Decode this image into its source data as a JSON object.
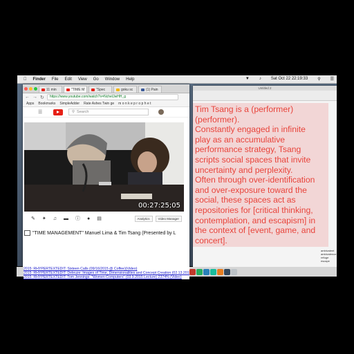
{
  "menubar": {
    "app": "Finder",
    "items": [
      "File",
      "Edit",
      "View",
      "Go",
      "Window",
      "Help"
    ],
    "clock": "Sat Oct 22  22:19:33"
  },
  "browser": {
    "tabs": [
      "11 min",
      "\"TIME M",
      "\"Spec",
      "goku sc",
      "(1) Pain"
    ],
    "url": "https://www.youtube.com/watch?v=NcheIJwHH_g",
    "bookmarks": [
      "Apps",
      "Bookmarks",
      "SimpleAdder",
      "Rate Ashes Twin ge",
      "m o n k e p r o p h e t"
    ],
    "search_placeholder": "Search",
    "video": {
      "timecode": "00:27:25;05"
    },
    "video_buttons": [
      "Analytics",
      "Video Manager"
    ],
    "video_title": "\"TIME MANAGEMENT\" Manuel Lima & Tim Tsang (Presented by L"
  },
  "links": [
    "2015: RHYPERTEXTEDIT: Sixteen Calls (09/16/2015 @ Coffee)(Video)",
    "2015: RHYPERTEXTEDIT: Deleuze: Images of Time, Dimensionalities and Concept Creation (02.13.2015)(Video)",
    "2015: RHYPERTEXTEDIT: Tom Jennings: \"Women Computers\" (03.9.2015 Lecture) 2374% (Video)"
  ],
  "textedit": {
    "window_title": "Untitled 2",
    "paragraph_lines": [
      "Tim Tsang is a (performer)",
      "(performer).",
      "Constantly engaged in infinite",
      "play as an accumulative",
      "performance strategy, Tsang",
      "scripts social spaces that invite",
      "uncertainty and perplexity.",
      "Often through over-identification",
      "and over-exposure toward the",
      "social, these spaces act as",
      "repositories for [critical thinking,",
      "contemplation, and escapism] in",
      "the context of [event, game, and",
      "concert]."
    ]
  },
  "finder_list": [
    "ambivalent",
    "ambivalence",
    "refuge",
    "escape"
  ],
  "colors": {
    "text_red": "#e8443b",
    "highlight": "#f2d6d6",
    "youtube_red": "#e62117"
  }
}
